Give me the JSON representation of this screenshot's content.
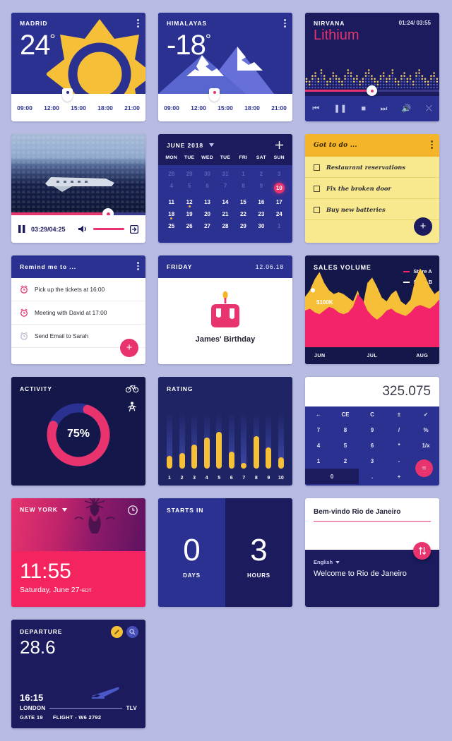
{
  "theme": {
    "bg": "#b9bce2",
    "navy": "#2b3191",
    "deep": "#1b1b5e",
    "pink": "#e8336e",
    "yellow": "#f5c038",
    "dark": "#14174a"
  },
  "weather_madrid": {
    "city": "MADRID",
    "temp": "24",
    "degree": "°",
    "hours": [
      "09:00",
      "12:00",
      "15:00",
      "18:00",
      "21:00"
    ],
    "menu_icon": "more-vertical-icon",
    "condition_icon": "sun-icon"
  },
  "weather_himalayas": {
    "city": "HIMALAYAS",
    "temp": "-18",
    "degree": "°",
    "hours": [
      "09:00",
      "12:00",
      "15:00",
      "18:00",
      "21:00"
    ],
    "menu_icon": "more-vertical-icon",
    "condition_icon": "mountains-icon"
  },
  "music": {
    "artist": "NIRVANA",
    "song": "Lithium",
    "time": "01:24/ 03:55",
    "controls": [
      "previous-icon",
      "pause-icon",
      "stop-icon",
      "next-icon",
      "volume-icon",
      "shuffle-icon"
    ],
    "control_glyphs": [
      "⏮",
      "❚❚",
      "■",
      "⏭",
      "🔊",
      "⤬"
    ],
    "progress_pct": 52
  },
  "video": {
    "time": "03:29/04:25",
    "play_icon": "pause-icon",
    "volume_icon": "volume-icon",
    "fullscreen_icon": "expand-icon",
    "progress_pct": 72
  },
  "calendar": {
    "month": "JUNE 2018",
    "add_icon": "plus-icon",
    "chevron_icon": "chevron-down-icon",
    "weekdays": [
      "MON",
      "TUE",
      "WED",
      "TUE",
      "FRI",
      "SAT",
      "SUN"
    ],
    "weeks": [
      [
        {
          "d": "28",
          "muted": true
        },
        {
          "d": "29",
          "muted": true
        },
        {
          "d": "30",
          "muted": true
        },
        {
          "d": "31",
          "muted": true
        },
        {
          "d": "1",
          "muted": true
        },
        {
          "d": "2",
          "muted": true
        },
        {
          "d": "3",
          "muted": true
        }
      ],
      [
        {
          "d": "4",
          "muted": true
        },
        {
          "d": "5",
          "muted": true
        },
        {
          "d": "6",
          "muted": true
        },
        {
          "d": "7",
          "muted": true
        },
        {
          "d": "8",
          "muted": true
        },
        {
          "d": "9",
          "muted": true
        },
        {
          "d": "10",
          "today": true
        }
      ],
      [
        {
          "d": "11"
        },
        {
          "d": "12",
          "dot": true
        },
        {
          "d": "13"
        },
        {
          "d": "14"
        },
        {
          "d": "15"
        },
        {
          "d": "16"
        },
        {
          "d": "17"
        }
      ],
      [
        {
          "d": "18",
          "dot": true
        },
        {
          "d": "19"
        },
        {
          "d": "20"
        },
        {
          "d": "21"
        },
        {
          "d": "22"
        },
        {
          "d": "23"
        },
        {
          "d": "24"
        }
      ],
      [
        {
          "d": "25"
        },
        {
          "d": "26"
        },
        {
          "d": "27"
        },
        {
          "d": "28"
        },
        {
          "d": "29"
        },
        {
          "d": "30"
        },
        {
          "d": "1",
          "muted": true
        }
      ]
    ]
  },
  "todo": {
    "title": "Got to do ...",
    "menu_icon": "more-vertical-icon",
    "add_icon": "plus-icon",
    "items": [
      {
        "label": "Restaurant reservations",
        "checked": false
      },
      {
        "label": "Fix the broken door",
        "checked": false
      },
      {
        "label": "Buy new batteries",
        "checked": false
      }
    ]
  },
  "reminders": {
    "title": "Remind me to ...",
    "menu_icon": "more-vertical-icon",
    "add_icon": "plus-icon",
    "items": [
      {
        "label": "Pick up the tickets at 16:00",
        "icon": "alarm-icon",
        "active": true
      },
      {
        "label": "Meeting with David at 17:00",
        "icon": "alarm-icon",
        "active": true
      },
      {
        "label": "Send Email to Sarah",
        "icon": "alarm-icon",
        "active": false
      }
    ]
  },
  "birthday": {
    "day": "FRIDAY",
    "date": "12.06.18",
    "name": "James' Birthday",
    "icon": "birthday-cake-icon"
  },
  "chart_data": {
    "type": "area",
    "title": "SALES VOLUME",
    "xlabel": "",
    "ylabel": "",
    "annotation": "$100K",
    "grid": false,
    "legend_position": "top-right",
    "categories": [
      "JUN",
      "JUL",
      "AUG"
    ],
    "series": [
      {
        "name": "Store A",
        "color": "#f4246b",
        "values": [
          40,
          42,
          38,
          36,
          40,
          44,
          42,
          38,
          36,
          38,
          44,
          58,
          52,
          40,
          34,
          30,
          34,
          40,
          42,
          38,
          36,
          34,
          38,
          44,
          46,
          44,
          42,
          46,
          52
        ]
      },
      {
        "name": "Store B",
        "color": "#f5c038",
        "values": [
          55,
          62,
          74,
          82,
          70,
          62,
          58,
          60,
          58,
          54,
          50,
          62,
          44,
          70,
          76,
          66,
          54,
          50,
          58,
          62,
          50,
          46,
          52,
          74,
          86,
          78,
          66,
          58,
          62
        ]
      }
    ]
  },
  "activity": {
    "title": "ACTIVITY",
    "percent": "75%",
    "value": 75,
    "icons": [
      "bicycle-icon",
      "walking-icon"
    ]
  },
  "rating": {
    "title": "RATING",
    "labels": [
      "1",
      "2",
      "3",
      "4",
      "5",
      "6",
      "7",
      "8",
      "9",
      "10"
    ],
    "values": [
      22,
      27,
      42,
      55,
      65,
      30,
      10,
      57,
      38,
      20
    ]
  },
  "calculator": {
    "display": "325.075",
    "keys": [
      [
        {
          "l": "←",
          "n": "backspace-key"
        },
        {
          "l": "CE",
          "n": "clear-entry-key"
        },
        {
          "l": "C",
          "n": "clear-key"
        },
        {
          "l": "±",
          "n": "plusminus-key"
        },
        {
          "l": "✓",
          "n": "check-key"
        }
      ],
      [
        {
          "l": "7",
          "n": "key-7"
        },
        {
          "l": "8",
          "n": "key-8"
        },
        {
          "l": "9",
          "n": "key-9"
        },
        {
          "l": "/",
          "n": "divide-key"
        },
        {
          "l": "%",
          "n": "percent-key"
        }
      ],
      [
        {
          "l": "4",
          "n": "key-4"
        },
        {
          "l": "5",
          "n": "key-5"
        },
        {
          "l": "6",
          "n": "key-6"
        },
        {
          "l": "*",
          "n": "multiply-key"
        },
        {
          "l": "1/x",
          "n": "reciprocal-key"
        }
      ],
      [
        {
          "l": "1",
          "n": "key-1"
        },
        {
          "l": "2",
          "n": "key-2"
        },
        {
          "l": "3",
          "n": "key-3"
        },
        {
          "l": "-",
          "n": "minus-key"
        },
        {
          "l": "",
          "n": "spacer"
        }
      ],
      [
        {
          "l": "0",
          "n": "key-0"
        },
        {
          "l": ".",
          "n": "decimal-key"
        },
        {
          "l": "+",
          "n": "plus-key"
        }
      ]
    ],
    "equals": "=",
    "equals_name": "equals-key"
  },
  "clock": {
    "city": "NEW YORK",
    "chevron_icon": "chevron-down-icon",
    "alarm_icon": "clock-icon",
    "time": "11:55",
    "date": "Saturday, June 27-",
    "zone": "EDT"
  },
  "countdown": {
    "title": "STARTS IN",
    "units": [
      {
        "value": "0",
        "label": "DAYS"
      },
      {
        "value": "3",
        "label": "HOURS"
      }
    ]
  },
  "translate": {
    "source_text": "Bem-vindo Rio de Janeiro",
    "target_lang": "English",
    "chevron_icon": "chevron-down-icon",
    "target_text": "Welcome to Rio de Janeiro",
    "swap_icon": "swap-vertical-icon"
  },
  "flight": {
    "title": "DEPARTURE",
    "number": "28.6",
    "time": "16:15",
    "origin": "LONDON",
    "destination": "TLV",
    "gate": "GATE 19",
    "flight_no": "FLIGHT - W6 2792",
    "badges": [
      "edit-icon",
      "search-icon"
    ],
    "plane_icon": "airplane-icon"
  }
}
